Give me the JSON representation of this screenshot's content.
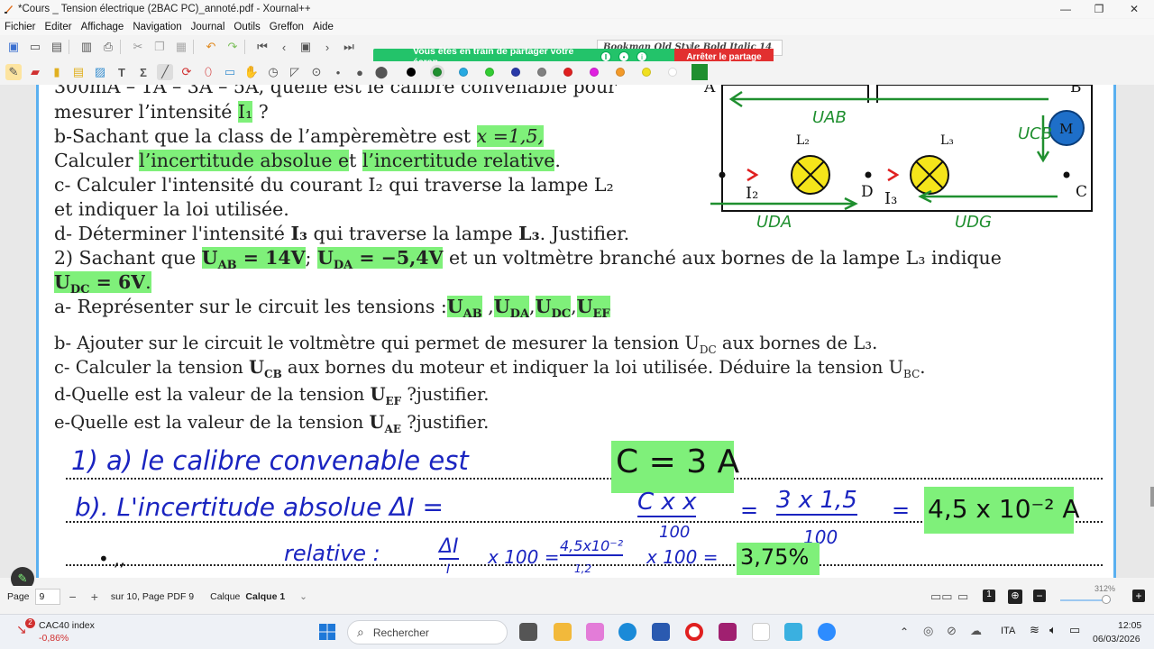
{
  "window": {
    "title": "*Cours _ Tension électrique (2BAC PC)_annoté.pdf - Xournal++",
    "minimize": "—",
    "maximize": "❐",
    "close": "✕"
  },
  "menu": [
    "Fichier",
    "Editer",
    "Affichage",
    "Navigation",
    "Journal",
    "Outils",
    "Greffon",
    "Aide"
  ],
  "toolbar": {
    "font": "Bookman Old Style Bold Italic",
    "font_size": "14"
  },
  "share": {
    "text": "Vous êtes en train de partager votre écran",
    "stop_label": "Arrêter le partage"
  },
  "colors": [
    "#000000",
    "#1f8f2f",
    "#27a9e1",
    "#33cc33",
    "#2a3aa8",
    "#808080",
    "#e02020",
    "#e020e0",
    "#f39a2a",
    "#f0e020",
    "#ffffff"
  ],
  "document": {
    "lines": {
      "l1": "300mA – 1A – 3A – 5A, quelle est le calibre convenable pour",
      "l2a": "mesurer l’intensité ",
      "l2b": "I₁",
      "l2c": " ?",
      "l3a": "b-Sachant que la class de l’ampèremètre est ",
      "l3b": "x =1,5,",
      "l4a": "Calculer ",
      "l4b": "l’incertitude absolue e",
      "l4c": "t ",
      "l4d": "l’incertitude relative",
      "l4e": ".",
      "l5": "c- Calculer l'intensité du courant I₂ qui traverse la lampe L₂",
      "l6": "et indiquer la loi utilisée.",
      "l7a": "d- Déterminer l'intensité ",
      "l7b": "I₃",
      "l7c": " qui traverse la lampe ",
      "l7d": "L₃",
      "l7e": ". Justifier.",
      "l8a": "2) Sachant que ",
      "l8b": "U",
      "l8b_sub": "AB",
      "l8b2": " = 14V",
      "l8c": "; ",
      "l8d": "U",
      "l8d_sub": "DA",
      "l8d2": " = −5,4V",
      "l8e": " et un voltmètre branché aux bornes de la lampe L₃ indique",
      "l9a": "U",
      "l9a_sub": "DC",
      "l9a2": "  = 6V",
      "l9b": ".",
      "l10a": "a- Représenter sur le circuit les tensions :",
      "l10b": "U",
      "l10b_sub": "AB",
      "l10c": " ,",
      "l10d": "U",
      "l10d_sub": "DA",
      "l10e": ",",
      "l10f": "U",
      "l10f_sub": "DC",
      "l10g": ",",
      "l10h": "U",
      "l10h_sub": "EF",
      "l11": "b- Ajouter sur le circuit le voltmètre qui permet de mesurer la tension U",
      "l11_sub": "DC",
      "l11b": " aux bornes de L₃.",
      "l12a": "c- Calculer la tension ",
      "l12b": "U",
      "l12b_sub": "CB",
      "l12c": " aux bornes du moteur et indiquer la loi utilisée. Déduire la tension U",
      "l12c_sub": "BC",
      "l12d": ".",
      "l13a": "d-Quelle est la valeur de la tension ",
      "l13b": "U",
      "l13b_sub": "EF",
      "l13c": " ?justifier.",
      "l14a": "e-Quelle est la valeur de la tension ",
      "l14b": "U",
      "l14b_sub": "AE",
      "l14c": " ?justifier."
    },
    "circuit": {
      "A": "A",
      "B": "B",
      "C": "C",
      "D": "D",
      "M": "M",
      "L2": "L₂",
      "L3": "L₃",
      "I2": "I₂",
      "I3": "I₃",
      "UAB": "UAB",
      "UCB": "UCB",
      "UDA": "UDA",
      "UDC": "UDG"
    },
    "handwriting": {
      "h1": "1) a)   le calibre convenable est",
      "h1box": "C = 3 A",
      "h2": "b). L'incertitude  absolue   ΔI  =",
      "h2frac_num": "C x x",
      "h2frac_den": "100",
      "h2eq": "=",
      "h2frac2_num": "3 x 1,5",
      "h2frac2_den": "100",
      "h2eq2": "=",
      "h2box": "4,5 x 10⁻² A",
      "h3": "relative :",
      "h3frac_num": "ΔI",
      "h3frac_den": "I",
      "h3mid": "x 100 =",
      "h3frac2_num": "4,5x10⁻²",
      "h3frac2_den": "1,2",
      "h3end": "x 100 =",
      "h3box": "3,75%",
      "h3dots": "•   ,,"
    }
  },
  "status": {
    "page_label": "Page",
    "page_value": "9",
    "of_label": "sur 10, Page PDF 9",
    "layer_label": "Calque",
    "layer_value": "Calque 1",
    "zoom": "312%"
  },
  "taskbar": {
    "stock_name": "CAC40 index",
    "stock_change": "-0,86%",
    "stock_badge": "2",
    "search_placeholder": "Rechercher",
    "lang": "ITA",
    "time": "12:05",
    "date": "06/03/2026"
  }
}
